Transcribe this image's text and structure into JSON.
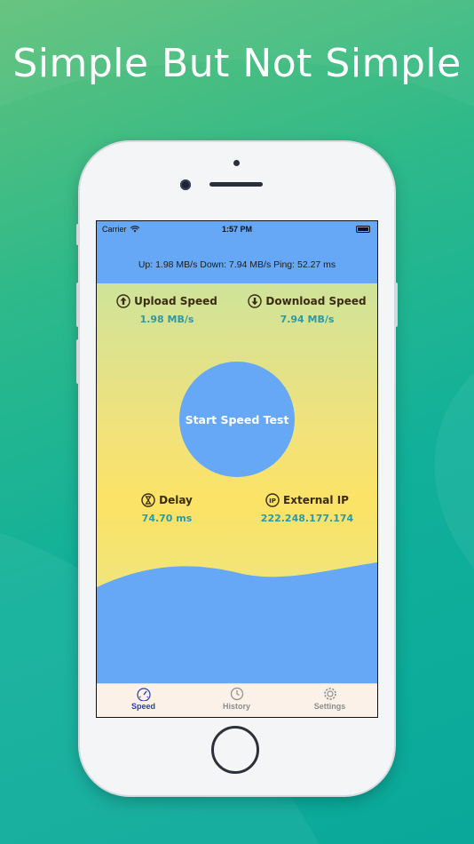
{
  "headline": "Simple But Not Simple",
  "status_bar": {
    "carrier": "Carrier",
    "time": "1:57 PM"
  },
  "summary": "Up: 1.98 MB/s Down: 7.94 MB/s Ping: 52.27 ms",
  "metrics": {
    "upload": {
      "label": "Upload Speed",
      "value": "1.98 MB/s",
      "icon": "upload-arrow-icon"
    },
    "download": {
      "label": "Download Speed",
      "value": "7.94 MB/s",
      "icon": "download-arrow-icon"
    },
    "delay": {
      "label": "Delay",
      "value": "74.70 ms",
      "icon": "hourglass-icon"
    },
    "external_ip": {
      "label": "External IP",
      "value": "222.248.177.174",
      "icon": "ip-icon"
    }
  },
  "start_button": "Start Speed Test",
  "tabs": [
    {
      "label": "Speed",
      "icon": "speedometer-icon",
      "active": true
    },
    {
      "label": "History",
      "icon": "clock-icon",
      "active": false
    },
    {
      "label": "Settings",
      "icon": "gear-icon",
      "active": false
    }
  ],
  "colors": {
    "accent_blue": "#66a8f6",
    "value_teal": "#2a9aa6",
    "active_tab": "#2a3fa0",
    "background_green": "#11b09a"
  }
}
